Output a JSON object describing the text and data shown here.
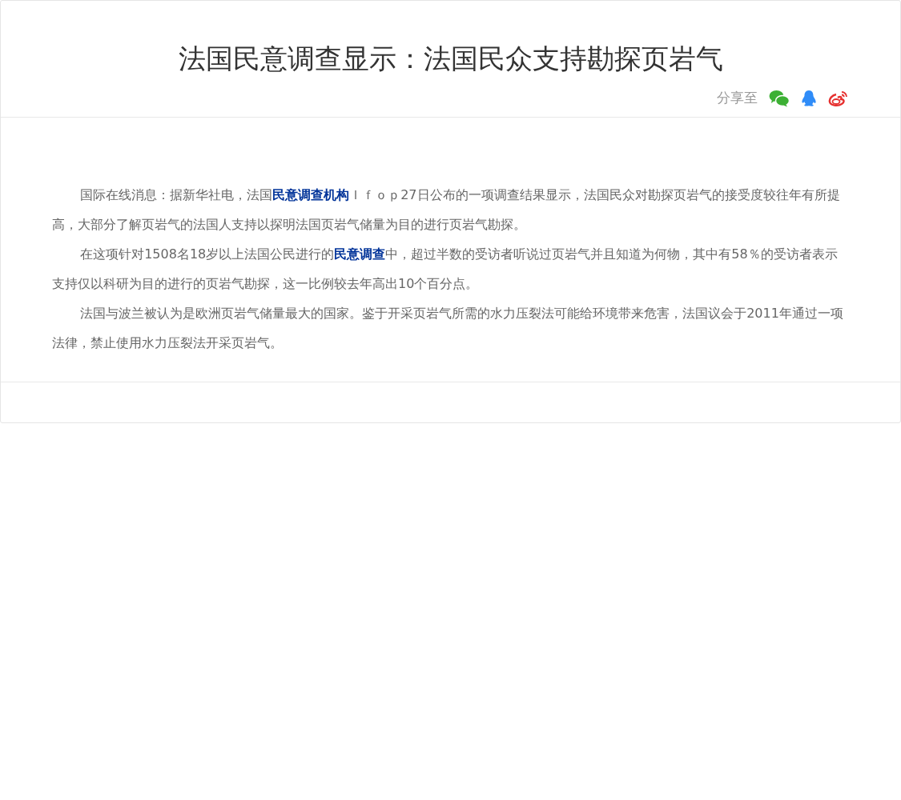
{
  "article": {
    "title": "法国民意调查显示：法国民众支持勘探页岩气",
    "share_label": "分享至",
    "share_buttons": [
      {
        "kind": "chat"
      },
      {
        "kind": "penguin"
      },
      {
        "kind": "swirl"
      }
    ],
    "paragraphs": [
      [
        {
          "kind": "text",
          "text": "国际在线消息：据新华社电，法国"
        },
        {
          "kind": "link",
          "text": "民意调查机构"
        },
        {
          "kind": "text",
          "text": "Ｉｆｏｐ27日公布的一项调查结果显示，法国民众对勘探页岩气的接受度较往年有所提高，大部分了解页岩气的法国人支持以探明法国页岩气储量为目的进行页岩气勘探。"
        }
      ],
      [
        {
          "kind": "text",
          "text": "在这项针对1508名18岁以上法国公民进行的"
        },
        {
          "kind": "link",
          "text": "民意调查"
        },
        {
          "kind": "text",
          "text": "中，超过半数的受访者听说过页岩气并且知道为何物，其中有58％的受访者表示支持仅以科研为目的进行的页岩气勘探，这一比例较去年高出10个百分点。"
        }
      ],
      [
        {
          "kind": "text",
          "text": "法国与波兰被认为是欧洲页岩气储量最大的国家。鉴于开采页岩气所需的水力压裂法可能给环境带来危害，法国议会于2011年通过一项法律，禁止使用水力压裂法开采页岩气。"
        }
      ]
    ]
  }
}
